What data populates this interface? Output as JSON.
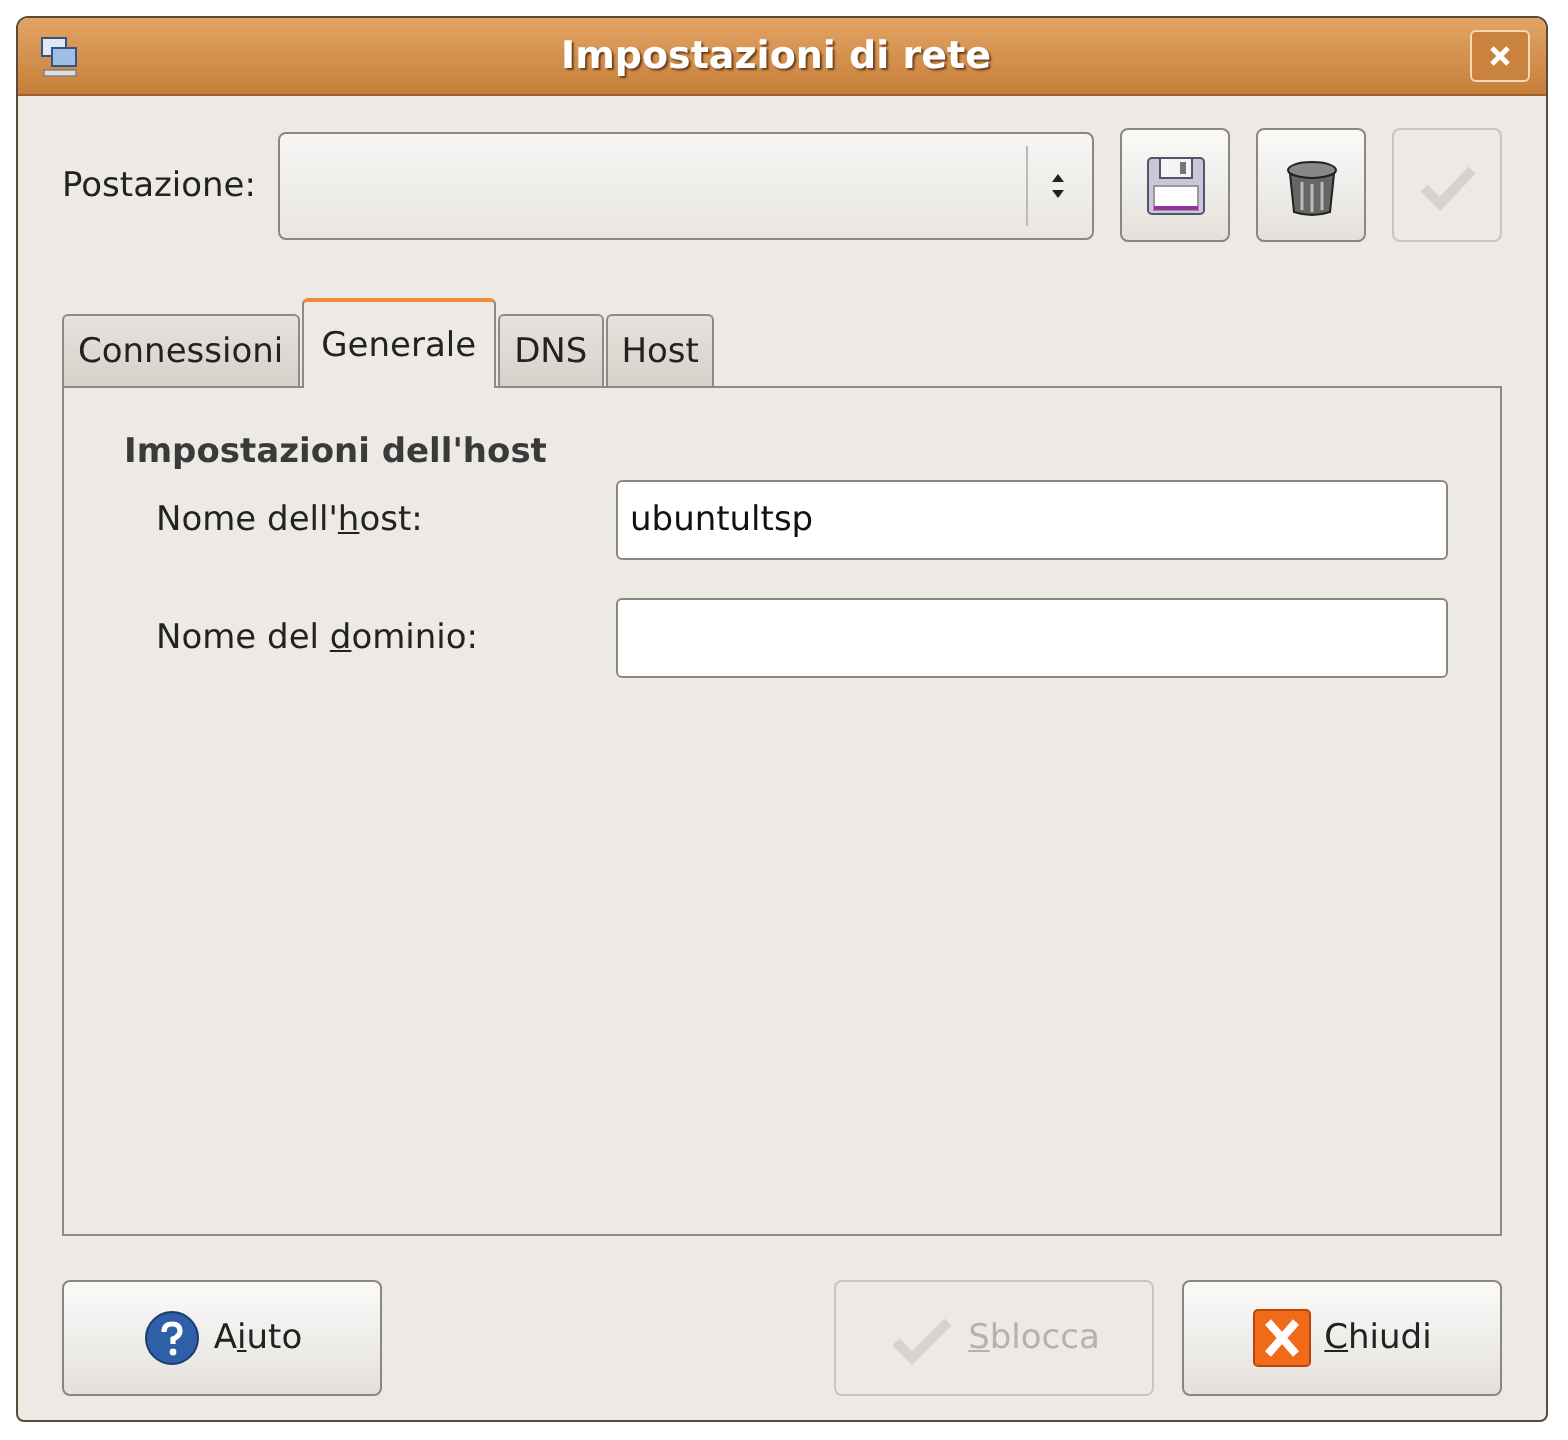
{
  "window": {
    "title": "Impostazioni di rete"
  },
  "location": {
    "label": "Postazione:",
    "save_disabled": false,
    "delete_disabled": false,
    "apply_disabled": true
  },
  "tabs": [
    {
      "label": "Connessioni",
      "selected": false
    },
    {
      "label": "Generale",
      "selected": true
    },
    {
      "label": "DNS",
      "selected": false
    },
    {
      "label": "Host",
      "selected": false
    }
  ],
  "section": {
    "title": "Impostazioni dell'host",
    "fields": [
      {
        "label": {
          "before": "Nome dell'",
          "key": "h",
          "after": "ost:"
        },
        "value": "ubuntultsp"
      },
      {
        "label": {
          "before": "Nome del ",
          "key": "d",
          "after": "ominio:"
        }
      }
    ]
  },
  "buttons": [
    {
      "kind": "help",
      "label": {
        "before": "A",
        "key": "i",
        "after": "uto"
      },
      "disabled": false
    },
    {
      "kind": "unlock",
      "label": {
        "key": "S",
        "after": "blocca"
      },
      "disabled": true
    },
    {
      "kind": "close",
      "label": {
        "key": "C",
        "after": "hiudi"
      },
      "disabled": false
    }
  ]
}
